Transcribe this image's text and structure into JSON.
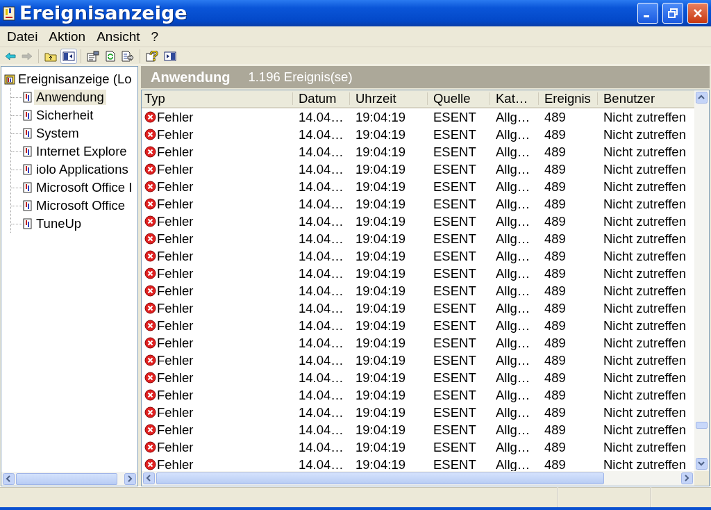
{
  "window": {
    "title": "Ereignisanzeige"
  },
  "menu": [
    {
      "label": "Datei"
    },
    {
      "label": "Aktion"
    },
    {
      "label": "Ansicht"
    },
    {
      "label": "?"
    }
  ],
  "toolbar": [
    {
      "kind": "back",
      "disabled": false,
      "selected": false
    },
    {
      "kind": "forward",
      "disabled": true,
      "selected": false
    },
    {
      "kind": "sep"
    },
    {
      "kind": "up",
      "disabled": false,
      "selected": false
    },
    {
      "kind": "tree",
      "disabled": false,
      "selected": true
    },
    {
      "kind": "sep"
    },
    {
      "kind": "properties",
      "disabled": false,
      "selected": false
    },
    {
      "kind": "refresh",
      "disabled": false,
      "selected": false
    },
    {
      "kind": "export",
      "disabled": false,
      "selected": false
    },
    {
      "kind": "sep"
    },
    {
      "kind": "help",
      "disabled": false,
      "selected": false
    },
    {
      "kind": "pane",
      "disabled": false,
      "selected": false
    }
  ],
  "tree": {
    "label": "Ereignisanzeige (Lo",
    "children": [
      {
        "label": "Anwendung",
        "selected": true
      },
      {
        "label": "Sicherheit",
        "selected": false
      },
      {
        "label": "System",
        "selected": false
      },
      {
        "label": "Internet Explore",
        "selected": false
      },
      {
        "label": "iolo Applications",
        "selected": false
      },
      {
        "label": "Microsoft Office I",
        "selected": false
      },
      {
        "label": "Microsoft Office",
        "selected": false
      },
      {
        "label": "TuneUp",
        "selected": false
      }
    ]
  },
  "list": {
    "title": "Anwendung",
    "count": "1.196 Ereignis(se)",
    "columns": [
      {
        "label": "Typ"
      },
      {
        "label": "Datum"
      },
      {
        "label": "Uhrzeit"
      },
      {
        "label": "Quelle"
      },
      {
        "label": "Kat…"
      },
      {
        "label": "Ereignis"
      },
      {
        "label": "Benutzer"
      }
    ],
    "rows": [
      {
        "kind": "error",
        "cells": [
          "Fehler",
          "14.04…",
          "19:04:19",
          "ESENT",
          "Allg…",
          "489",
          "Nicht zutreffen"
        ]
      },
      {
        "kind": "error",
        "cells": [
          "Fehler",
          "14.04…",
          "19:04:19",
          "ESENT",
          "Allg…",
          "489",
          "Nicht zutreffen"
        ]
      },
      {
        "kind": "error",
        "cells": [
          "Fehler",
          "14.04…",
          "19:04:19",
          "ESENT",
          "Allg…",
          "489",
          "Nicht zutreffen"
        ]
      },
      {
        "kind": "error",
        "cells": [
          "Fehler",
          "14.04…",
          "19:04:19",
          "ESENT",
          "Allg…",
          "489",
          "Nicht zutreffen"
        ]
      },
      {
        "kind": "error",
        "cells": [
          "Fehler",
          "14.04…",
          "19:04:19",
          "ESENT",
          "Allg…",
          "489",
          "Nicht zutreffen"
        ]
      },
      {
        "kind": "error",
        "cells": [
          "Fehler",
          "14.04…",
          "19:04:19",
          "ESENT",
          "Allg…",
          "489",
          "Nicht zutreffen"
        ]
      },
      {
        "kind": "error",
        "cells": [
          "Fehler",
          "14.04…",
          "19:04:19",
          "ESENT",
          "Allg…",
          "489",
          "Nicht zutreffen"
        ]
      },
      {
        "kind": "error",
        "cells": [
          "Fehler",
          "14.04…",
          "19:04:19",
          "ESENT",
          "Allg…",
          "489",
          "Nicht zutreffen"
        ]
      },
      {
        "kind": "error",
        "cells": [
          "Fehler",
          "14.04…",
          "19:04:19",
          "ESENT",
          "Allg…",
          "489",
          "Nicht zutreffen"
        ]
      },
      {
        "kind": "error",
        "cells": [
          "Fehler",
          "14.04…",
          "19:04:19",
          "ESENT",
          "Allg…",
          "489",
          "Nicht zutreffen"
        ]
      },
      {
        "kind": "error",
        "cells": [
          "Fehler",
          "14.04…",
          "19:04:19",
          "ESENT",
          "Allg…",
          "489",
          "Nicht zutreffen"
        ]
      },
      {
        "kind": "error",
        "cells": [
          "Fehler",
          "14.04…",
          "19:04:19",
          "ESENT",
          "Allg…",
          "489",
          "Nicht zutreffen"
        ]
      },
      {
        "kind": "error",
        "cells": [
          "Fehler",
          "14.04…",
          "19:04:19",
          "ESENT",
          "Allg…",
          "489",
          "Nicht zutreffen"
        ]
      },
      {
        "kind": "error",
        "cells": [
          "Fehler",
          "14.04…",
          "19:04:19",
          "ESENT",
          "Allg…",
          "489",
          "Nicht zutreffen"
        ]
      },
      {
        "kind": "error",
        "cells": [
          "Fehler",
          "14.04…",
          "19:04:19",
          "ESENT",
          "Allg…",
          "489",
          "Nicht zutreffen"
        ]
      },
      {
        "kind": "error",
        "cells": [
          "Fehler",
          "14.04…",
          "19:04:19",
          "ESENT",
          "Allg…",
          "489",
          "Nicht zutreffen"
        ]
      },
      {
        "kind": "error",
        "cells": [
          "Fehler",
          "14.04…",
          "19:04:19",
          "ESENT",
          "Allg…",
          "489",
          "Nicht zutreffen"
        ]
      },
      {
        "kind": "error",
        "cells": [
          "Fehler",
          "14.04…",
          "19:04:19",
          "ESENT",
          "Allg…",
          "489",
          "Nicht zutreffen"
        ]
      },
      {
        "kind": "error",
        "cells": [
          "Fehler",
          "14.04…",
          "19:04:19",
          "ESENT",
          "Allg…",
          "489",
          "Nicht zutreffen"
        ]
      },
      {
        "kind": "error",
        "cells": [
          "Fehler",
          "14.04…",
          "19:04:19",
          "ESENT",
          "Allg…",
          "489",
          "Nicht zutreffen"
        ]
      },
      {
        "kind": "error",
        "cells": [
          "Fehler",
          "14.04…",
          "19:04:19",
          "ESENT",
          "Allg…",
          "489",
          "Nicht zutreffen"
        ]
      }
    ]
  }
}
